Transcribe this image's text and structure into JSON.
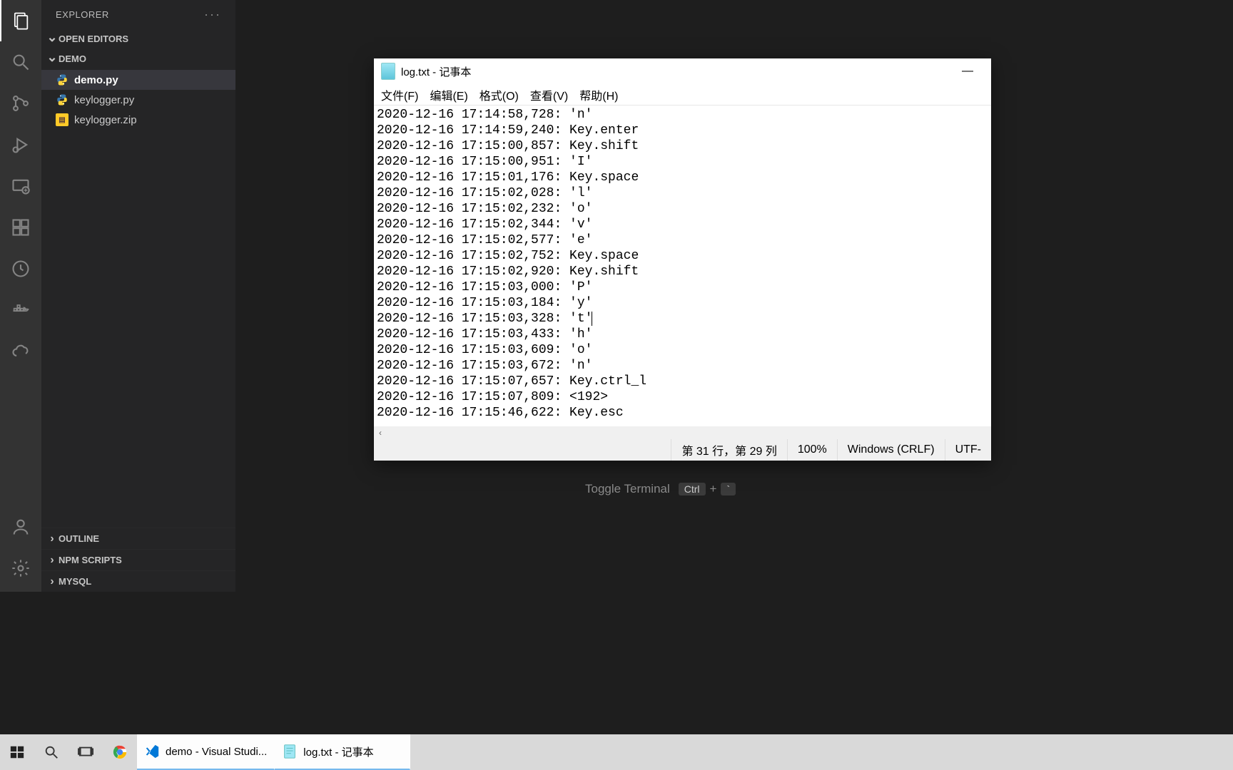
{
  "sidebar": {
    "title": "EXPLORER",
    "sections": {
      "openEditors": "OPEN EDITORS",
      "project": "DEMO",
      "outline": "OUTLINE",
      "npm": "NPM SCRIPTS",
      "mysql": "MYSQL"
    },
    "files": [
      {
        "name": "demo.py",
        "type": "python",
        "active": true
      },
      {
        "name": "keylogger.py",
        "type": "python",
        "active": false
      },
      {
        "name": "keylogger.zip",
        "type": "zip",
        "active": false
      }
    ]
  },
  "hint": {
    "label": "Toggle Terminal",
    "keys": [
      "Ctrl",
      "+",
      "`"
    ]
  },
  "notepad": {
    "title": "log.txt - 记事本",
    "menus": [
      "文件(F)",
      "编辑(E)",
      "格式(O)",
      "查看(V)",
      "帮助(H)"
    ],
    "lines": [
      "2020-12-16 17:14:58,728: 'n'",
      "2020-12-16 17:14:59,240: Key.enter",
      "2020-12-16 17:15:00,857: Key.shift",
      "2020-12-16 17:15:00,951: 'I'",
      "2020-12-16 17:15:01,176: Key.space",
      "2020-12-16 17:15:02,028: 'l'",
      "2020-12-16 17:15:02,232: 'o'",
      "2020-12-16 17:15:02,344: 'v'",
      "2020-12-16 17:15:02,577: 'e'",
      "2020-12-16 17:15:02,752: Key.space",
      "2020-12-16 17:15:02,920: Key.shift",
      "2020-12-16 17:15:03,000: 'P'",
      "2020-12-16 17:15:03,184: 'y'",
      "2020-12-16 17:15:03,328: 't'",
      "2020-12-16 17:15:03,433: 'h'",
      "2020-12-16 17:15:03,609: 'o'",
      "2020-12-16 17:15:03,672: 'n'",
      "2020-12-16 17:15:07,657: Key.ctrl_l",
      "2020-12-16 17:15:07,809: <192>",
      "2020-12-16 17:15:46,622: Key.esc"
    ],
    "caretLine": 13,
    "status": {
      "pos": "第 31 行，第 29 列",
      "zoom": "100%",
      "eol": "Windows (CRLF)",
      "encoding": "UTF-"
    }
  },
  "taskbar": {
    "apps": [
      {
        "label": "demo - Visual Studi...",
        "icon": "vscode"
      },
      {
        "label": "log.txt - 记事本",
        "icon": "notepad"
      }
    ]
  }
}
